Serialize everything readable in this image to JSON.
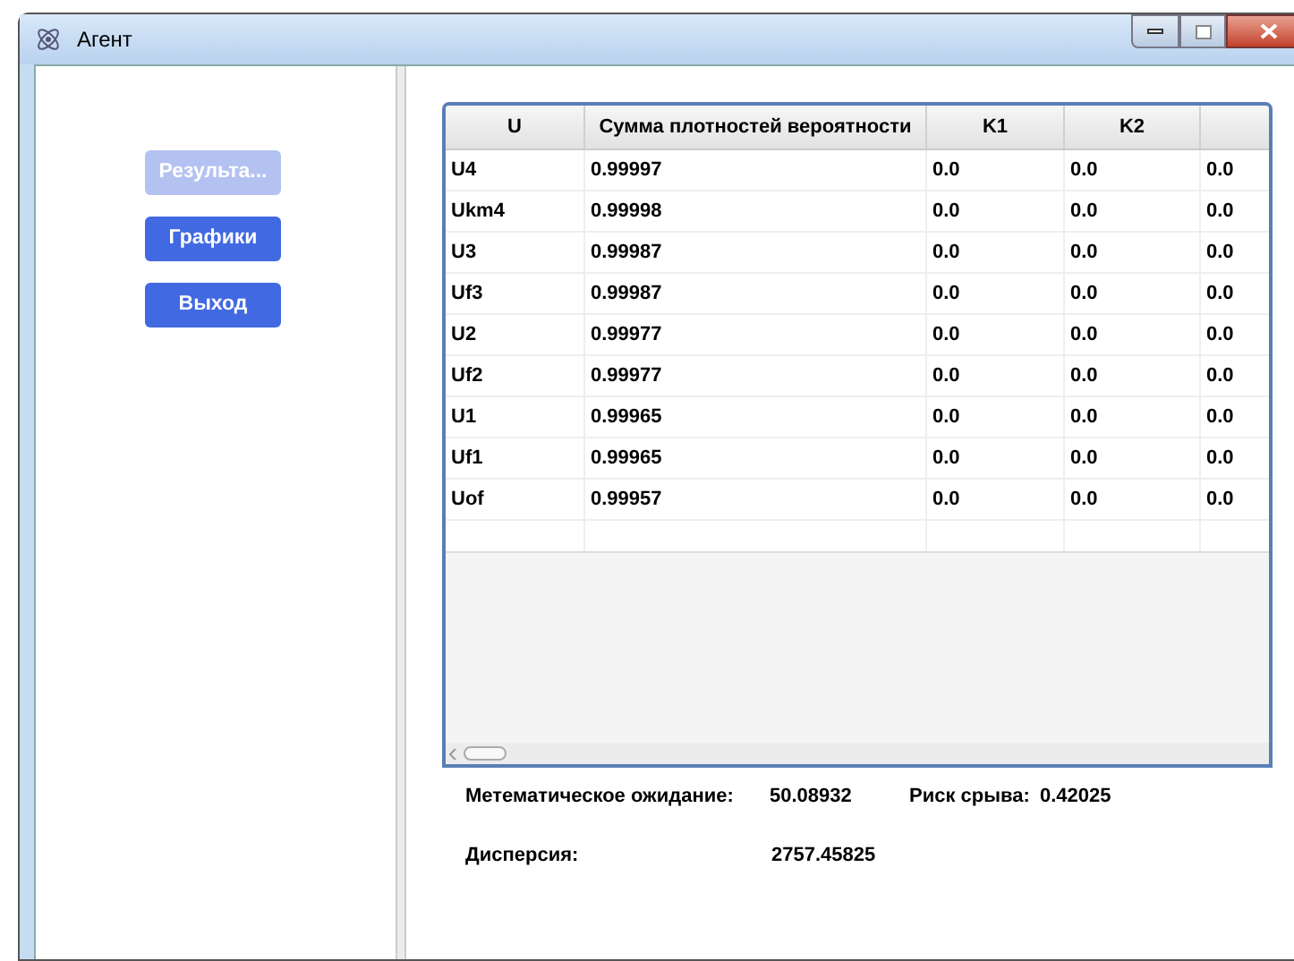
{
  "window": {
    "title": "Агент"
  },
  "sidebar": {
    "buttons": [
      {
        "label": "Результа...",
        "disabled": true
      },
      {
        "label": "Графики",
        "disabled": false
      },
      {
        "label": "Выход",
        "disabled": false
      }
    ]
  },
  "table": {
    "columns": [
      "U",
      "Сумма плотностей вероятности",
      "K1",
      "K2"
    ],
    "rows": [
      [
        "U4",
        "0.99997",
        "0.0",
        "0.0",
        "0.0"
      ],
      [
        "Ukm4",
        "0.99998",
        "0.0",
        "0.0",
        "0.0"
      ],
      [
        "U3",
        "0.99987",
        "0.0",
        "0.0",
        "0.0"
      ],
      [
        "Uf3",
        "0.99987",
        "0.0",
        "0.0",
        "0.0"
      ],
      [
        "U2",
        "0.99977",
        "0.0",
        "0.0",
        "0.0"
      ],
      [
        "Uf2",
        "0.99977",
        "0.0",
        "0.0",
        "0.0"
      ],
      [
        "U1",
        "0.99965",
        "0.0",
        "0.0",
        "0.0"
      ],
      [
        "Uf1",
        "0.99965",
        "0.0",
        "0.0",
        "0.0"
      ],
      [
        "Uof",
        "0.99957",
        "0.0",
        "0.0",
        "0.0"
      ]
    ]
  },
  "stats": [
    {
      "label": "Метематическое ожидание:",
      "value": "50.08932"
    },
    {
      "label": "Риск срыва:",
      "value": "0.42025"
    },
    {
      "label": "Дисперсия:",
      "value": "2757.45825"
    }
  ]
}
